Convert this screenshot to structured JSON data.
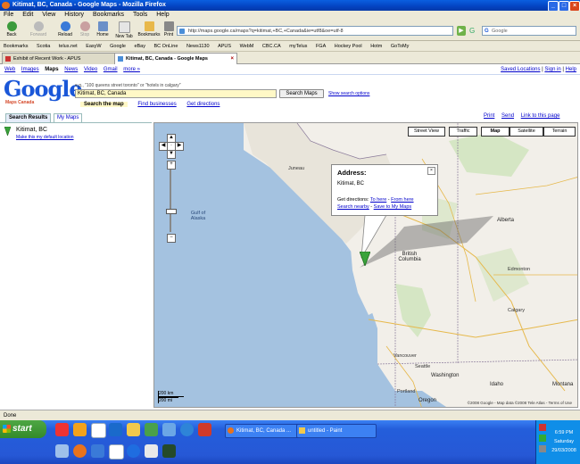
{
  "window": {
    "title": "Kitimat, BC, Canada - Google Maps - Mozilla Firefox",
    "controls": [
      "_",
      "□",
      "×"
    ]
  },
  "menu": [
    "File",
    "Edit",
    "View",
    "History",
    "Bookmarks",
    "Tools",
    "Help"
  ],
  "nav": {
    "buttons": [
      "Back",
      "Forward",
      "Reload",
      "Stop",
      "Home",
      "New Tab",
      "Bookmarks",
      "Print"
    ],
    "url": "http://maps.google.ca/maps?q=kitimat,+BC,+Canada&ie=utf8&oe=utf-8",
    "search_placeholder": "Google"
  },
  "bookmarks": [
    "Bookmarks",
    "Scotia",
    "telus.net",
    "EasyW",
    "Google",
    "eBay",
    "BC OnLine",
    "News1130",
    "APUS",
    "WebM",
    "CBC.CA",
    "myTelus",
    "FGA",
    "Hockey Pool",
    "Hotm",
    "GoToMy"
  ],
  "tabs": [
    {
      "label": "Exhibit of Recent Work - APUS",
      "active": false
    },
    {
      "label": "Kitimat, BC, Canada - Google Maps",
      "active": true
    }
  ],
  "gnav": {
    "links": [
      "Web",
      "Images",
      "Maps",
      "News",
      "Video",
      "Gmail",
      "more »"
    ],
    "current": "Maps",
    "right": [
      "Saved Locations",
      "Sign in",
      "Help"
    ]
  },
  "logo": {
    "text": "Google",
    "sub": "Maps Canada"
  },
  "search": {
    "hint": "e.g., \"100 queens street toronto\" or \"hotels in calgary\"",
    "value": "Kitimat, BC, Canada",
    "button": "Search Maps",
    "options": "Show search options",
    "subtabs": [
      "Search the map",
      "Find businesses",
      "Get directions"
    ]
  },
  "tools": [
    "Print",
    "Send",
    "Link to this page"
  ],
  "panel": {
    "tabs": [
      "Search Results",
      "My Maps"
    ],
    "result_title": "Kitimat, BC",
    "result_link": "Make this my default location"
  },
  "map": {
    "buttons": [
      "Street View",
      "Traffic",
      "Map",
      "Satellite",
      "Terrain"
    ],
    "selected": "Map",
    "bubble": {
      "title": "Address:",
      "address": "Kitimat, BC",
      "dir_label": "Get directions:",
      "to_here": "To here",
      "from_here": "From here",
      "nearby": "Search nearby",
      "save": "Save to My Maps"
    },
    "labels": [
      "Gulf of Alaska",
      "Alberta",
      "British Columbia",
      "Edmonton",
      "Calgary",
      "Washington",
      "Oregon",
      "Vancouver",
      "Seattle",
      "Portland",
      "Juneau",
      "Idaho",
      "Montana"
    ],
    "scale": [
      "200 km",
      "200 mi"
    ],
    "copyright": "©2008 Google - Map data ©2008 Tele Atlas - Terms of Use"
  },
  "status": "Done",
  "taskbar": {
    "start": "start",
    "tasks": [
      "Kitimat, BC, Canada ...",
      "untitled - Paint"
    ],
    "time": "6:59 PM",
    "day": "Saturday",
    "date": "29/03/2008"
  }
}
